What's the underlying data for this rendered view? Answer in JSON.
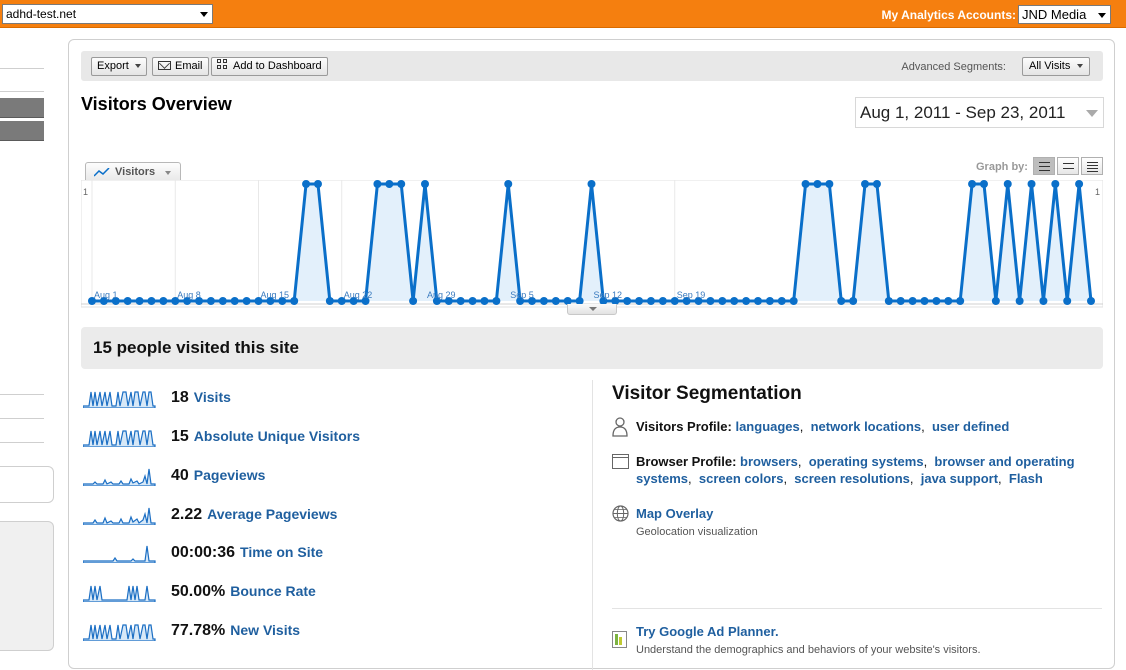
{
  "topbar": {
    "site": "adhd-test.net",
    "accounts_label": "My Analytics Accounts:",
    "account": "JND Media"
  },
  "toolbar": {
    "export": "Export",
    "email": "Email",
    "add_dashboard": "Add to Dashboard",
    "segments_label": "Advanced Segments:",
    "segments_value": "All Visits"
  },
  "page_title": "Visitors Overview",
  "date_range": "Aug 1, 2011 - Sep 23, 2011",
  "graph": {
    "metric_tab": "Visitors",
    "graph_by": "Graph by:"
  },
  "chart_data": {
    "type": "area",
    "series": [
      {
        "name": "Visitors",
        "values": [
          0,
          0,
          0,
          0,
          0,
          0,
          0,
          0,
          0,
          0,
          0,
          0,
          0,
          0,
          0,
          0,
          0,
          0,
          1,
          1,
          0,
          0,
          0,
          0,
          1,
          1,
          1,
          0,
          1,
          0,
          0,
          0,
          0,
          0,
          0,
          1,
          0,
          0,
          0,
          0,
          0,
          0,
          1,
          0,
          0,
          0,
          0,
          0,
          0,
          0,
          0,
          0,
          0,
          0,
          0,
          0,
          0,
          0,
          0,
          0,
          1,
          1,
          1,
          0,
          0,
          1,
          1,
          0,
          0,
          0,
          0,
          0,
          0,
          0,
          1,
          1,
          0,
          1,
          0,
          1,
          0,
          1,
          0,
          1,
          0
        ]
      }
    ],
    "x_start": "Aug 1, 2011",
    "tick_labels": [
      "Aug 1",
      "Aug 8",
      "Aug 15",
      "Aug 22",
      "Aug 29",
      "Sep 5",
      "Sep 12",
      "Sep 19"
    ],
    "y_tick_left": "1",
    "y_tick_right": "1",
    "ylim": [
      0,
      1
    ],
    "color": "#0a6fc9",
    "fill": "#e3f0fb"
  },
  "summary": "15 people visited this site",
  "metrics": [
    {
      "value": "18",
      "label": "Visits"
    },
    {
      "value": "15",
      "label": "Absolute Unique Visitors"
    },
    {
      "value": "40",
      "label": "Pageviews"
    },
    {
      "value": "2.22",
      "label": "Average Pageviews"
    },
    {
      "value": "00:00:36",
      "label": "Time on Site"
    },
    {
      "value": "50.00%",
      "label": "Bounce Rate"
    },
    {
      "value": "77.78%",
      "label": "New Visits"
    }
  ],
  "segmentation": {
    "title": "Visitor Segmentation",
    "visitors_profile": {
      "label": "Visitors Profile:",
      "links": [
        "languages",
        "network locations",
        "user defined"
      ]
    },
    "browser_profile": {
      "label": "Browser Profile:",
      "links": [
        "browsers",
        "operating systems",
        "browser and operating systems",
        "screen colors",
        "screen resolutions",
        "java support",
        "Flash"
      ]
    },
    "map_overlay": {
      "title": "Map Overlay",
      "subtitle": "Geolocation visualization"
    },
    "ad_planner": {
      "title": "Try Google Ad Planner.",
      "subtitle": "Understand the demographics and behaviors of your website's visitors."
    }
  }
}
